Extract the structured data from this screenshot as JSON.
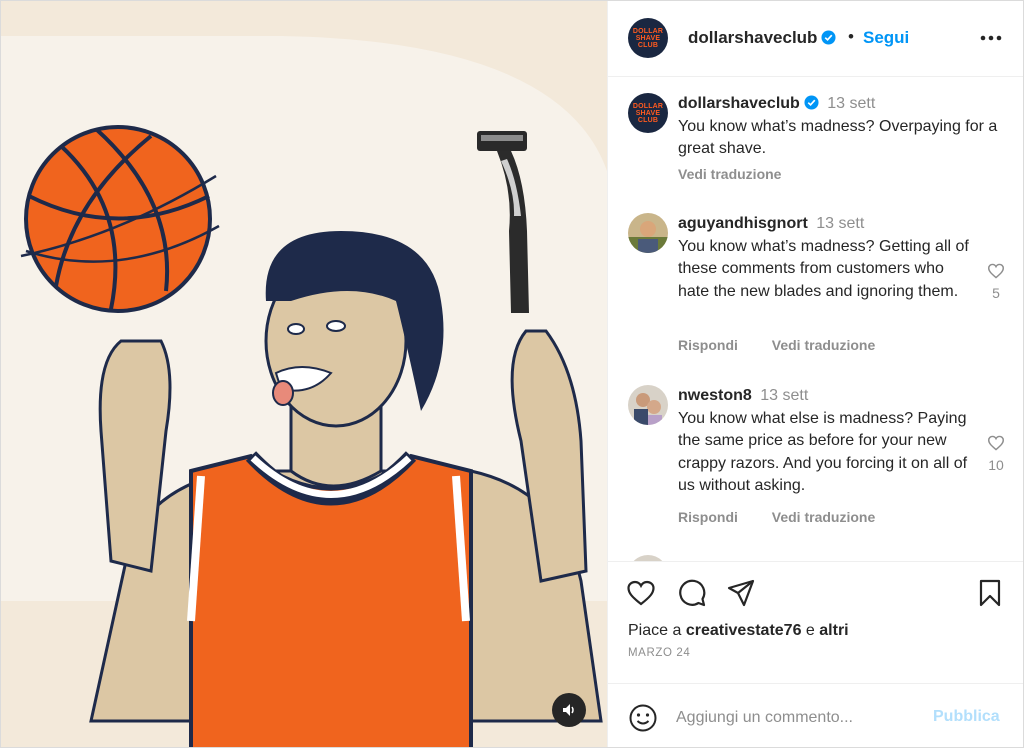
{
  "post": {
    "author": "dollarshaveclub",
    "follow_label": "Segui",
    "separator": "•",
    "logo_lines": [
      "DOLLAR",
      "SHAVE",
      "CLUB"
    ]
  },
  "caption": {
    "username": "dollarshaveclub",
    "time": "13 sett",
    "text": "You know what’s madness? Overpaying for a great shave.",
    "translate": "Vedi traduzione"
  },
  "comments": [
    {
      "username": "aguyandhisgnort",
      "time": "13 sett",
      "text": "You know what’s madness? Getting all of these comments from customers who hate the new blades and ignoring them.",
      "likes": "5",
      "reply": "Rispondi",
      "translate": "Vedi traduzione"
    },
    {
      "username": "nweston8",
      "time": "13 sett",
      "text": "You know what else is madness? Paying the same price as before for your new crappy razors. And you forcing it on all of us without asking.",
      "likes": "10",
      "reply": "Rispondi",
      "translate": "Vedi traduzione"
    }
  ],
  "likes_line": {
    "prefix": "Piace a",
    "user": "creativestate76",
    "joiner": "e",
    "others": "altri"
  },
  "post_date": "MARZO 24",
  "add_comment": {
    "placeholder": "Aggiungi un commento...",
    "publish": "Pubblica"
  },
  "icons": {
    "more": "more-horizontal-icon",
    "like": "heart-icon",
    "comment": "comment-icon",
    "share": "share-icon",
    "save": "bookmark-icon",
    "emoji": "emoji-icon",
    "mute": "volume-icon",
    "verified": "verified-badge-icon"
  },
  "colors": {
    "link_blue": "#0095f6",
    "publish_disabled": "#b2dffc",
    "muted_text": "#8e8e8e",
    "brand_navy": "#1a2741",
    "brand_orange": "#ff5a1f",
    "jersey_orange": "#f0641e"
  }
}
